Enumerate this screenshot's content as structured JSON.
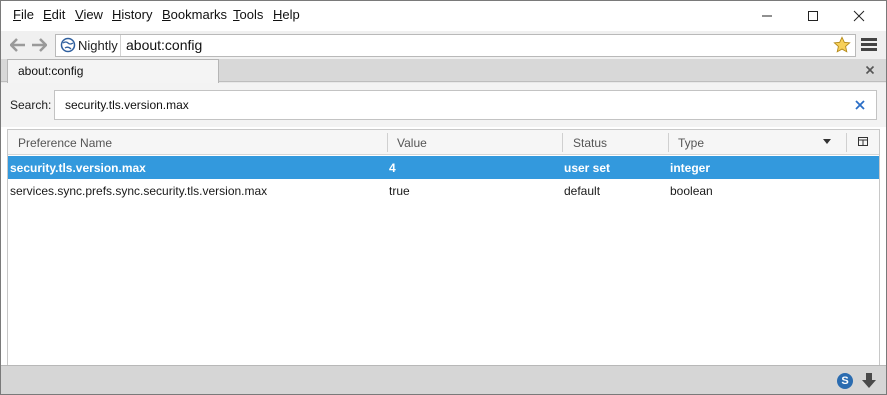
{
  "menubar": {
    "items": [
      {
        "label": "File",
        "accel": "F",
        "rest": "ile"
      },
      {
        "label": "Edit",
        "accel": "E",
        "rest": "dit"
      },
      {
        "label": "View",
        "accel": "V",
        "rest": "iew"
      },
      {
        "label": "History",
        "accel": "H",
        "rest": "istory"
      },
      {
        "label": "Bookmarks",
        "accel": "B",
        "rest": "ookmarks"
      },
      {
        "label": "Tools",
        "accel": "T",
        "rest": "ools"
      },
      {
        "label": "Help",
        "accel": "H",
        "rest": "elp"
      }
    ]
  },
  "navbar": {
    "identity_label": "Nightly",
    "url": "about:config",
    "icons": [
      "back-arrow-icon",
      "forward-arrow-icon",
      "globe-icon",
      "star-bookmark-icon",
      "hamburger-menu-icon"
    ]
  },
  "tabs": [
    {
      "label": "about:config"
    }
  ],
  "search": {
    "label": "Search:",
    "value": "security.tls.version.max"
  },
  "table": {
    "columns": [
      "Preference Name",
      "Value",
      "Status",
      "Type"
    ],
    "rows": [
      {
        "name": "security.tls.version.max",
        "value": "4",
        "status": "user set",
        "type": "integer",
        "selected": true
      },
      {
        "name": "services.sync.prefs.sync.security.tls.version.max",
        "value": "true",
        "status": "default",
        "type": "boolean",
        "selected": false
      }
    ]
  },
  "statusbar": {
    "s_label": "S",
    "icons": [
      "s-badge-icon",
      "download-arrow-icon"
    ]
  },
  "colors": {
    "selection": "#3399dd",
    "accent_blue": "#2a6ec6"
  }
}
